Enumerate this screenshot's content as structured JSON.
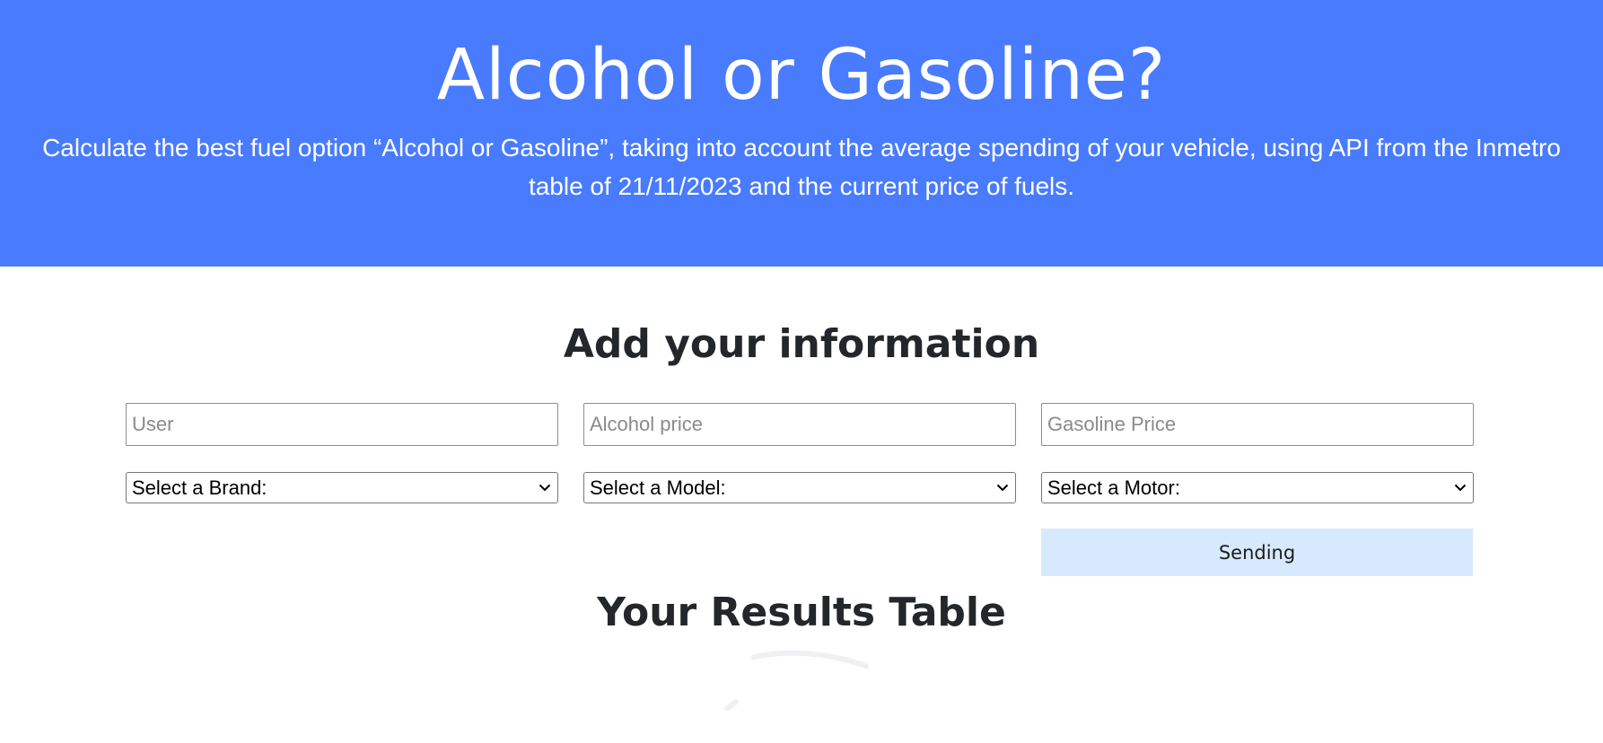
{
  "header": {
    "title": "Alcohol or Gasoline?",
    "description": "Calculate the best fuel option “Alcohol or Gasoline”, taking into account the average spending of your vehicle, using API from the Inmetro table of 21/11/2023 and the current price of fuels.",
    "background_color": "#487bfd"
  },
  "form": {
    "title": "Add your information",
    "user_placeholder": "User",
    "alcohol_price_placeholder": "Alcohol price",
    "gasoline_price_placeholder": "Gasoline Price",
    "brand_select": "Select a Brand:",
    "model_select": "Select a Model:",
    "motor_select": "Select a Motor:",
    "submit_label": "Sending",
    "submit_color": "#d7e9fd"
  },
  "results": {
    "title": "Your Results Table"
  },
  "icons": {
    "select_arrow": "chevron-down-icon"
  }
}
